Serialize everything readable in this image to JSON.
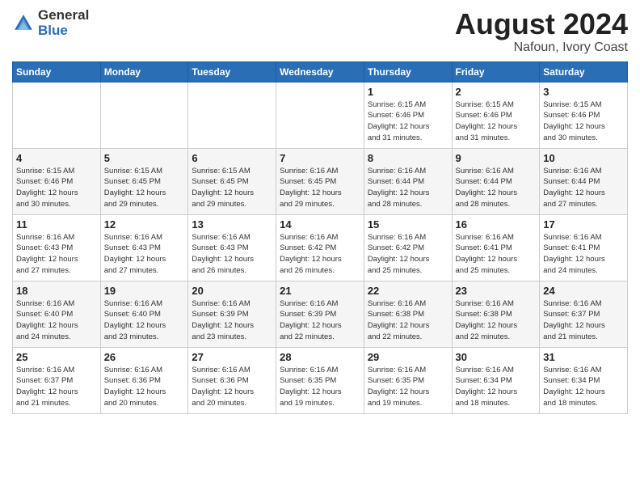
{
  "header": {
    "logo_general": "General",
    "logo_blue": "Blue",
    "month_year": "August 2024",
    "location": "Nafoun, Ivory Coast"
  },
  "weekdays": [
    "Sunday",
    "Monday",
    "Tuesday",
    "Wednesday",
    "Thursday",
    "Friday",
    "Saturday"
  ],
  "weeks": [
    [
      {
        "day": "",
        "info": ""
      },
      {
        "day": "",
        "info": ""
      },
      {
        "day": "",
        "info": ""
      },
      {
        "day": "",
        "info": ""
      },
      {
        "day": "1",
        "info": "Sunrise: 6:15 AM\nSunset: 6:46 PM\nDaylight: 12 hours\nand 31 minutes."
      },
      {
        "day": "2",
        "info": "Sunrise: 6:15 AM\nSunset: 6:46 PM\nDaylight: 12 hours\nand 31 minutes."
      },
      {
        "day": "3",
        "info": "Sunrise: 6:15 AM\nSunset: 6:46 PM\nDaylight: 12 hours\nand 30 minutes."
      }
    ],
    [
      {
        "day": "4",
        "info": "Sunrise: 6:15 AM\nSunset: 6:46 PM\nDaylight: 12 hours\nand 30 minutes."
      },
      {
        "day": "5",
        "info": "Sunrise: 6:15 AM\nSunset: 6:45 PM\nDaylight: 12 hours\nand 29 minutes."
      },
      {
        "day": "6",
        "info": "Sunrise: 6:15 AM\nSunset: 6:45 PM\nDaylight: 12 hours\nand 29 minutes."
      },
      {
        "day": "7",
        "info": "Sunrise: 6:16 AM\nSunset: 6:45 PM\nDaylight: 12 hours\nand 29 minutes."
      },
      {
        "day": "8",
        "info": "Sunrise: 6:16 AM\nSunset: 6:44 PM\nDaylight: 12 hours\nand 28 minutes."
      },
      {
        "day": "9",
        "info": "Sunrise: 6:16 AM\nSunset: 6:44 PM\nDaylight: 12 hours\nand 28 minutes."
      },
      {
        "day": "10",
        "info": "Sunrise: 6:16 AM\nSunset: 6:44 PM\nDaylight: 12 hours\nand 27 minutes."
      }
    ],
    [
      {
        "day": "11",
        "info": "Sunrise: 6:16 AM\nSunset: 6:43 PM\nDaylight: 12 hours\nand 27 minutes."
      },
      {
        "day": "12",
        "info": "Sunrise: 6:16 AM\nSunset: 6:43 PM\nDaylight: 12 hours\nand 27 minutes."
      },
      {
        "day": "13",
        "info": "Sunrise: 6:16 AM\nSunset: 6:43 PM\nDaylight: 12 hours\nand 26 minutes."
      },
      {
        "day": "14",
        "info": "Sunrise: 6:16 AM\nSunset: 6:42 PM\nDaylight: 12 hours\nand 26 minutes."
      },
      {
        "day": "15",
        "info": "Sunrise: 6:16 AM\nSunset: 6:42 PM\nDaylight: 12 hours\nand 25 minutes."
      },
      {
        "day": "16",
        "info": "Sunrise: 6:16 AM\nSunset: 6:41 PM\nDaylight: 12 hours\nand 25 minutes."
      },
      {
        "day": "17",
        "info": "Sunrise: 6:16 AM\nSunset: 6:41 PM\nDaylight: 12 hours\nand 24 minutes."
      }
    ],
    [
      {
        "day": "18",
        "info": "Sunrise: 6:16 AM\nSunset: 6:40 PM\nDaylight: 12 hours\nand 24 minutes."
      },
      {
        "day": "19",
        "info": "Sunrise: 6:16 AM\nSunset: 6:40 PM\nDaylight: 12 hours\nand 23 minutes."
      },
      {
        "day": "20",
        "info": "Sunrise: 6:16 AM\nSunset: 6:39 PM\nDaylight: 12 hours\nand 23 minutes."
      },
      {
        "day": "21",
        "info": "Sunrise: 6:16 AM\nSunset: 6:39 PM\nDaylight: 12 hours\nand 22 minutes."
      },
      {
        "day": "22",
        "info": "Sunrise: 6:16 AM\nSunset: 6:38 PM\nDaylight: 12 hours\nand 22 minutes."
      },
      {
        "day": "23",
        "info": "Sunrise: 6:16 AM\nSunset: 6:38 PM\nDaylight: 12 hours\nand 22 minutes."
      },
      {
        "day": "24",
        "info": "Sunrise: 6:16 AM\nSunset: 6:37 PM\nDaylight: 12 hours\nand 21 minutes."
      }
    ],
    [
      {
        "day": "25",
        "info": "Sunrise: 6:16 AM\nSunset: 6:37 PM\nDaylight: 12 hours\nand 21 minutes."
      },
      {
        "day": "26",
        "info": "Sunrise: 6:16 AM\nSunset: 6:36 PM\nDaylight: 12 hours\nand 20 minutes."
      },
      {
        "day": "27",
        "info": "Sunrise: 6:16 AM\nSunset: 6:36 PM\nDaylight: 12 hours\nand 20 minutes."
      },
      {
        "day": "28",
        "info": "Sunrise: 6:16 AM\nSunset: 6:35 PM\nDaylight: 12 hours\nand 19 minutes."
      },
      {
        "day": "29",
        "info": "Sunrise: 6:16 AM\nSunset: 6:35 PM\nDaylight: 12 hours\nand 19 minutes."
      },
      {
        "day": "30",
        "info": "Sunrise: 6:16 AM\nSunset: 6:34 PM\nDaylight: 12 hours\nand 18 minutes."
      },
      {
        "day": "31",
        "info": "Sunrise: 6:16 AM\nSunset: 6:34 PM\nDaylight: 12 hours\nand 18 minutes."
      }
    ]
  ]
}
